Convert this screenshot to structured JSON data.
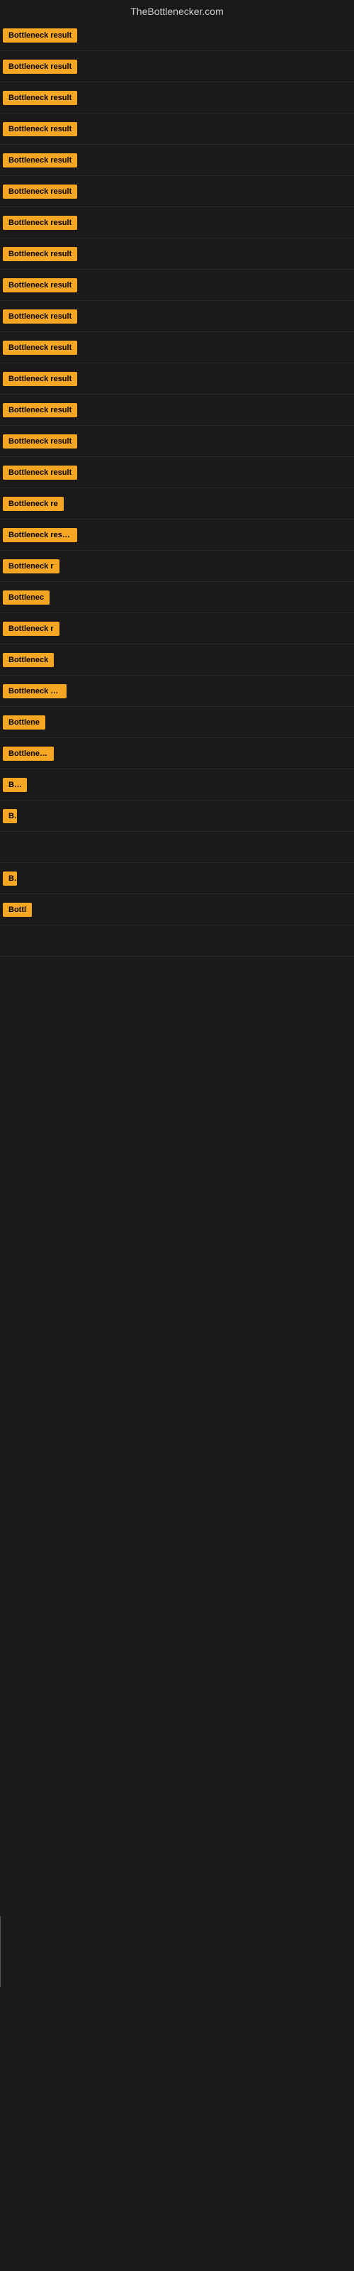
{
  "header": {
    "title": "TheBottlenecker.com"
  },
  "items": [
    {
      "id": 1,
      "label": "Bottleneck result",
      "width": 120
    },
    {
      "id": 2,
      "label": "Bottleneck result",
      "width": 120
    },
    {
      "id": 3,
      "label": "Bottleneck result",
      "width": 120
    },
    {
      "id": 4,
      "label": "Bottleneck result",
      "width": 120
    },
    {
      "id": 5,
      "label": "Bottleneck result",
      "width": 120
    },
    {
      "id": 6,
      "label": "Bottleneck result",
      "width": 120
    },
    {
      "id": 7,
      "label": "Bottleneck result",
      "width": 120
    },
    {
      "id": 8,
      "label": "Bottleneck result",
      "width": 120
    },
    {
      "id": 9,
      "label": "Bottleneck result",
      "width": 120
    },
    {
      "id": 10,
      "label": "Bottleneck result",
      "width": 120
    },
    {
      "id": 11,
      "label": "Bottleneck result",
      "width": 120
    },
    {
      "id": 12,
      "label": "Bottleneck result",
      "width": 110
    },
    {
      "id": 13,
      "label": "Bottleneck result",
      "width": 110
    },
    {
      "id": 14,
      "label": "Bottleneck result",
      "width": 110
    },
    {
      "id": 15,
      "label": "Bottleneck result",
      "width": 110
    },
    {
      "id": 16,
      "label": "Bottleneck re",
      "width": 95
    },
    {
      "id": 17,
      "label": "Bottleneck result",
      "width": 105
    },
    {
      "id": 18,
      "label": "Bottleneck r",
      "width": 85
    },
    {
      "id": 19,
      "label": "Bottlenec",
      "width": 72
    },
    {
      "id": 20,
      "label": "Bottleneck r",
      "width": 82
    },
    {
      "id": 21,
      "label": "Bottleneck",
      "width": 76
    },
    {
      "id": 22,
      "label": "Bottleneck res",
      "width": 90
    },
    {
      "id": 23,
      "label": "Bottlene",
      "width": 66
    },
    {
      "id": 24,
      "label": "Bottleneck",
      "width": 72
    },
    {
      "id": 25,
      "label": "Bot",
      "width": 34
    },
    {
      "id": 26,
      "label": "B",
      "width": 20
    },
    {
      "id": 27,
      "label": "",
      "width": 0
    },
    {
      "id": 28,
      "label": "B",
      "width": 14
    },
    {
      "id": 29,
      "label": "Bottl",
      "width": 44
    },
    {
      "id": 30,
      "label": "",
      "width": 0
    }
  ]
}
